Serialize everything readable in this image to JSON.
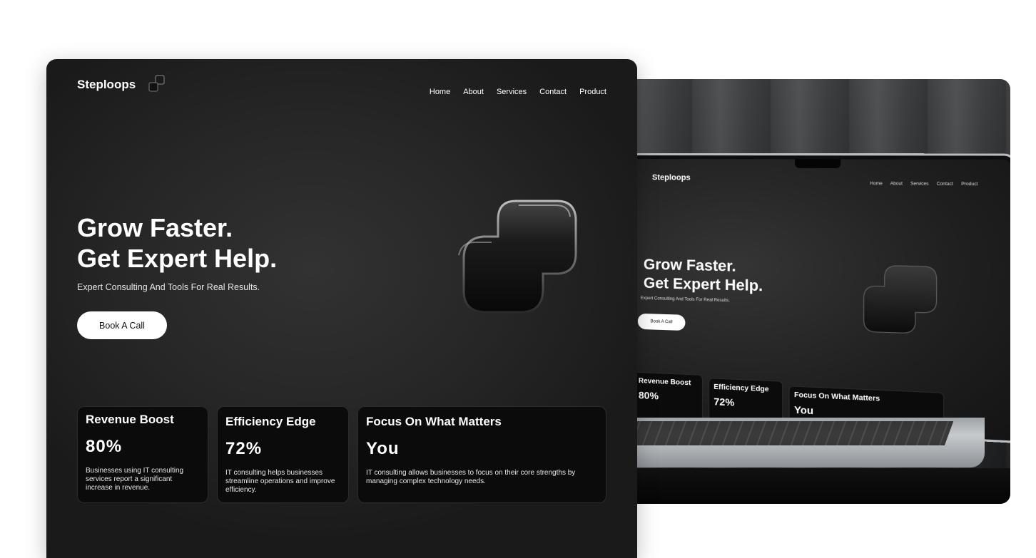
{
  "brand": "Steploops",
  "nav": [
    "Home",
    "About",
    "Services",
    "Contact",
    "Product"
  ],
  "hero": {
    "title_line1": "Grow Faster.",
    "title_line2": "Get Expert Help.",
    "subtitle": "Expert Consulting And Tools For Real Results.",
    "cta": "Book A Call"
  },
  "cards": [
    {
      "title": "Revenue Boost",
      "value": "80%",
      "desc": "Businesses using IT consulting services report a significant increase in revenue."
    },
    {
      "title": "Efficiency Edge",
      "value": "72%",
      "desc": "IT consulting helps businesses streamline operations and improve efficiency."
    },
    {
      "title": "Focus On What Matters",
      "value": "You",
      "desc": "IT consulting allows businesses to focus on their core strengths by managing complex technology needs."
    }
  ],
  "mockup": {
    "brand": "Steploops",
    "nav": [
      "Home",
      "About",
      "Services",
      "Contact",
      "Product"
    ],
    "title_line1": "Grow Faster.",
    "title_line2": "Get Expert Help.",
    "subtitle": "Expert Consulting And Tools For Real Results.",
    "cta": "Book A Call",
    "cards": [
      {
        "title": "Revenue Boost",
        "value": "80%"
      },
      {
        "title": "Efficiency Edge",
        "value": "72%"
      },
      {
        "title": "Focus On What Matters",
        "value": "You"
      }
    ]
  },
  "colors": {
    "background": "#262626",
    "card": "#0b0b0b",
    "text": "#ffffff",
    "button": "#ffffff"
  }
}
